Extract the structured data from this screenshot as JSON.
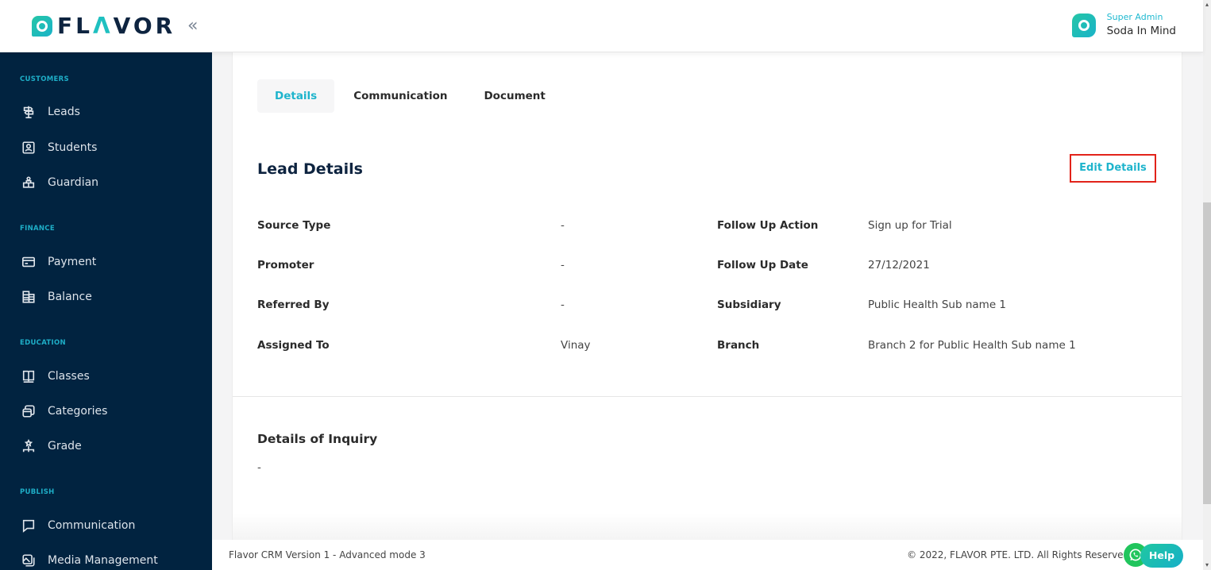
{
  "header": {
    "logo": {
      "text_before": "FL",
      "text_accent": "Λ",
      "text_after": "VOR"
    },
    "collapse_icon": "«",
    "user": {
      "role": "Super Admin",
      "name": "Soda In Mind"
    }
  },
  "sidebar": {
    "sections": [
      {
        "label": "CUSTOMERS",
        "items": [
          {
            "label": "Leads",
            "icon": "signpost-icon"
          },
          {
            "label": "Students",
            "icon": "student-card-icon"
          },
          {
            "label": "Guardian",
            "icon": "guardian-icon"
          }
        ]
      },
      {
        "label": "FINANCE",
        "items": [
          {
            "label": "Payment",
            "icon": "credit-card-icon"
          },
          {
            "label": "Balance",
            "icon": "ledger-icon"
          }
        ]
      },
      {
        "label": "EDUCATION",
        "items": [
          {
            "label": "Classes",
            "icon": "book-icon"
          },
          {
            "label": "Categories",
            "icon": "stacked-boxes-icon"
          },
          {
            "label": "Grade",
            "icon": "hierarchy-icon"
          }
        ]
      },
      {
        "label": "PUBLISH",
        "items": [
          {
            "label": "Communication",
            "icon": "message-icon"
          },
          {
            "label": "Media Management",
            "icon": "media-icon"
          }
        ]
      }
    ]
  },
  "main": {
    "tabs": [
      {
        "label": "Details",
        "active": true
      },
      {
        "label": "Communication",
        "active": false
      },
      {
        "label": "Document",
        "active": false
      }
    ],
    "section_title": "Lead Details",
    "edit_button": "Edit Details",
    "fields_left": [
      {
        "label": "Source Type",
        "value": "-"
      },
      {
        "label": "Promoter",
        "value": "-"
      },
      {
        "label": "Referred By",
        "value": "-"
      },
      {
        "label": "Assigned To",
        "value": "Vinay"
      }
    ],
    "fields_right": [
      {
        "label": "Follow Up Action",
        "value": "Sign up for Trial"
      },
      {
        "label": "Follow Up Date",
        "value": "27/12/2021"
      },
      {
        "label": "Subsidiary",
        "value": "Public Health Sub name 1"
      },
      {
        "label": "Branch",
        "value": "Branch 2 for Public Health Sub name 1"
      }
    ],
    "inquiry": {
      "title": "Details of Inquiry",
      "value": "-"
    }
  },
  "footer": {
    "version": "Flavor CRM Version 1 - Advanced mode 3",
    "copyright": "© 2022, FLAVOR PTE. LTD. All Rights Reserved.",
    "help_label": "Help"
  },
  "colors": {
    "sidebar_bg": "#012340",
    "accent": "#1eb4cc",
    "highlight_border": "#e2231a",
    "whatsapp": "#21c55d"
  }
}
